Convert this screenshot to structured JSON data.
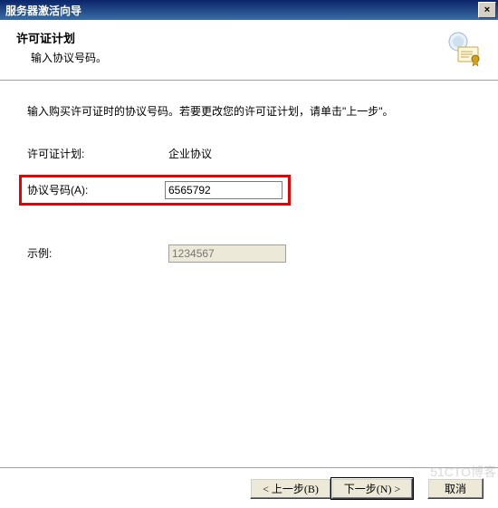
{
  "titlebar": {
    "title": "服务器激活向导",
    "close": "×"
  },
  "header": {
    "heading": "许可证计划",
    "subheading": "输入协议号码。"
  },
  "content": {
    "instruction": "输入购买许可证时的协议号码。若要更改您的许可证计划，请单击\"上一步\"。",
    "plan_label": "许可证计划:",
    "plan_value": "企业协议",
    "agreement_label": "协议号码(A):",
    "agreement_value": "6565792",
    "example_label": "示例:",
    "example_placeholder": "1234567"
  },
  "footer": {
    "back": "< 上一步(B)",
    "next": "下一步(N) >",
    "cancel": "取消"
  },
  "watermark": "51CTO博客"
}
